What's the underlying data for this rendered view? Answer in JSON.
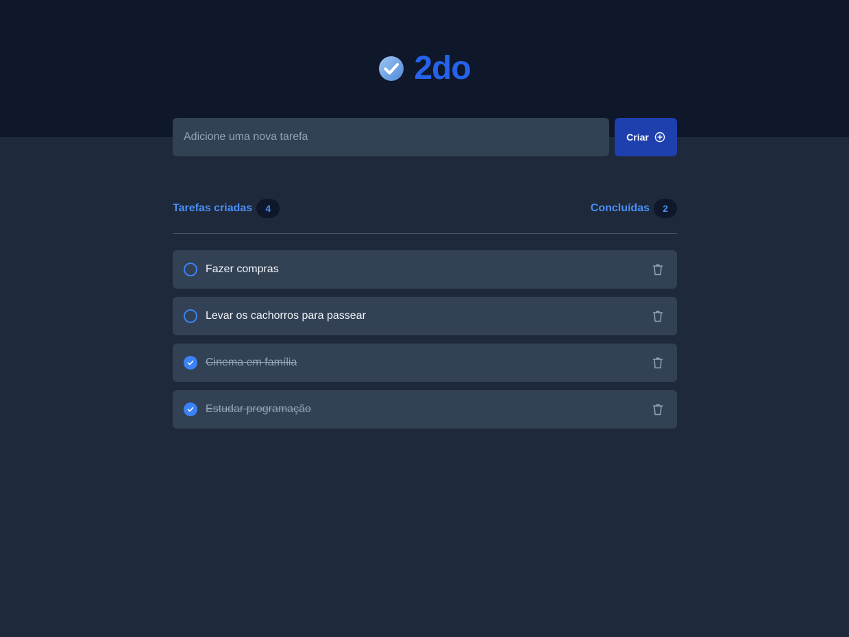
{
  "app": {
    "name": "2do",
    "accent_color": "#2563eb"
  },
  "form": {
    "placeholder": "Adicione uma nova tarefa",
    "value": "",
    "create_label": "Criar",
    "create_icon": "plus-circle-icon"
  },
  "counters": {
    "created_label": "Tarefas criadas",
    "created_count": "4",
    "done_label": "Concluídas",
    "done_count": "2"
  },
  "tasks": [
    {
      "title": "Fazer compras",
      "done": false
    },
    {
      "title": "Levar os cachorros para passear",
      "done": false
    },
    {
      "title": "Cinema em família",
      "done": true
    },
    {
      "title": "Estudar programação",
      "done": true
    }
  ],
  "icons": {
    "logo": "check-badge-icon",
    "unchecked": "circle-icon",
    "checked": "check-circle-icon",
    "delete": "trash-icon"
  }
}
